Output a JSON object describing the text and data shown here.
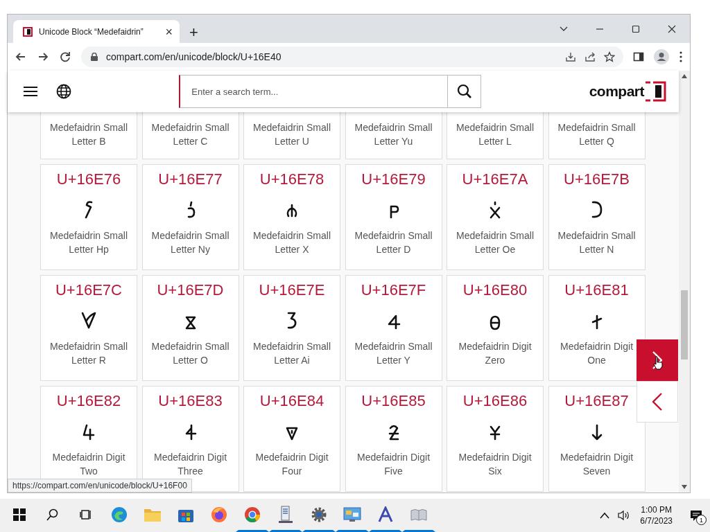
{
  "browser": {
    "tab": {
      "title": "Unicode Block “Medefaidrin”",
      "close": "×"
    },
    "new_tab": "+",
    "address": "compart.com/en/unicode/block/U+16E40",
    "status_url": "https://compart.com/en/unicode/block/U+16F00"
  },
  "site": {
    "search": {
      "placeholder": "Enter a search term..."
    },
    "logo": "compart"
  },
  "cut_row": [
    {
      "name": "Medefaidrin Small Letter B"
    },
    {
      "name": "Medefaidrin Small Letter C"
    },
    {
      "name": "Medefaidrin Small Letter U"
    },
    {
      "name": "Medefaidrin Small Letter Yu"
    },
    {
      "name": "Medefaidrin Small Letter L"
    },
    {
      "name": "Medefaidrin Small Letter Q"
    }
  ],
  "cards": [
    {
      "code": "U+16E76",
      "name": "Medefaidrin Small Letter Hp"
    },
    {
      "code": "U+16E77",
      "name": "Medefaidrin Small Letter Ny"
    },
    {
      "code": "U+16E78",
      "name": "Medefaidrin Small Letter X"
    },
    {
      "code": "U+16E79",
      "name": "Medefaidrin Small Letter D"
    },
    {
      "code": "U+16E7A",
      "name": "Medefaidrin Small Letter Oe"
    },
    {
      "code": "U+16E7B",
      "name": "Medefaidrin Small Letter N"
    },
    {
      "code": "U+16E7C",
      "name": "Medefaidrin Small Letter R"
    },
    {
      "code": "U+16E7D",
      "name": "Medefaidrin Small Letter O"
    },
    {
      "code": "U+16E7E",
      "name": "Medefaidrin Small Letter Ai"
    },
    {
      "code": "U+16E7F",
      "name": "Medefaidrin Small Letter Y"
    },
    {
      "code": "U+16E80",
      "name": "Medefaidrin Digit Zero"
    },
    {
      "code": "U+16E81",
      "name": "Medefaidrin Digit One"
    },
    {
      "code": "U+16E82",
      "name": "Medefaidrin Digit Two"
    },
    {
      "code": "U+16E83",
      "name": "Medefaidrin Digit Three"
    },
    {
      "code": "U+16E84",
      "name": "Medefaidrin Digit Four"
    },
    {
      "code": "U+16E85",
      "name": "Medefaidrin Digit Five"
    },
    {
      "code": "U+16E86",
      "name": "Medefaidrin Digit Six"
    },
    {
      "code": "U+16E87",
      "name": "Medefaidrin Digit Seven"
    }
  ],
  "taskbar": {
    "apps": [
      {
        "open": false
      },
      {
        "open": false
      },
      {
        "open": false
      },
      {
        "open": false
      },
      {
        "open": true
      },
      {
        "open": true
      },
      {
        "open": true
      },
      {
        "open": true
      },
      {
        "open": true
      },
      {
        "open": true
      }
    ],
    "time": "1:00 PM",
    "date": "6/7/2023",
    "notifications": "1"
  }
}
